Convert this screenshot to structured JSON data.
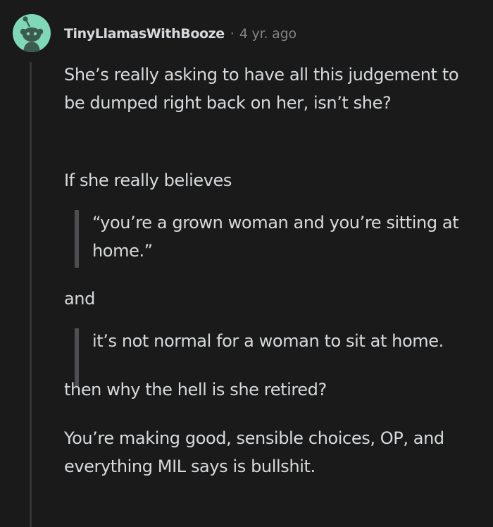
{
  "comment": {
    "author": "TinyLlamasWithBooze",
    "separator": "·",
    "time": "4 yr. ago",
    "avatar_icon": "snoo-avatar-icon",
    "paragraphs": [
      "She’s really asking to have all this judgement to be dumped right back on her, isn’t she?",
      "If she really believes",
      "“you’re a grown woman and you’re sitting at home.”",
      "and",
      "it’s not normal for a woman to sit at home.",
      "then why the hell is she retired?",
      "You’re making good, sensible choices, OP, and everything MIL says is bullshit."
    ]
  },
  "colors": {
    "background": "#1a1a1b",
    "text": "#d7dadc",
    "meta": "#818384",
    "avatar_bg": "#7fd8b6",
    "quote_bar": "#4e4f50",
    "thread_line": "#343536"
  }
}
